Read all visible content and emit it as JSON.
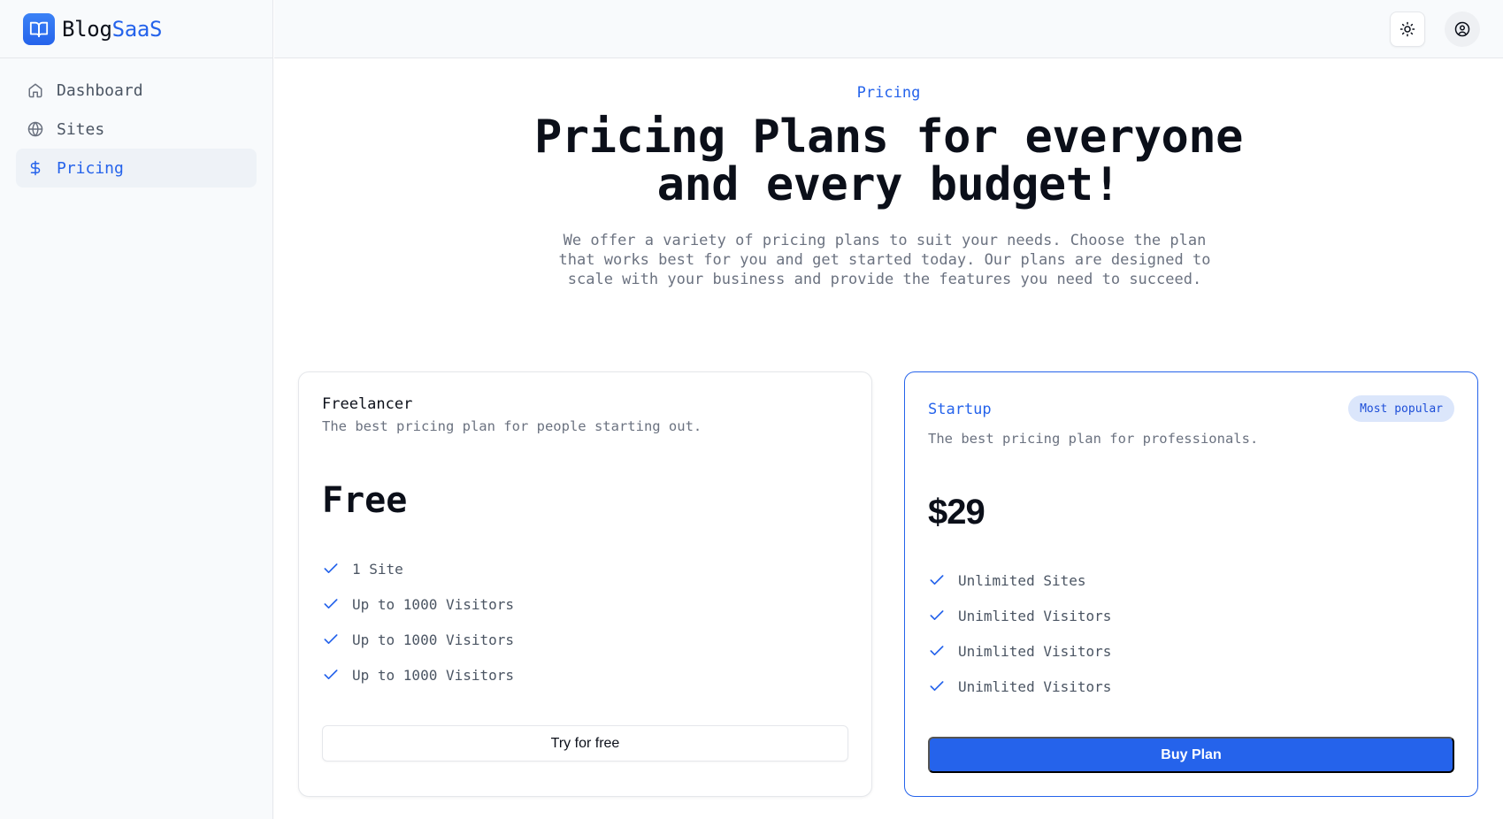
{
  "brand": {
    "name_prefix": "Blog",
    "name_suffix": "SaaS",
    "logo_icon": "book-open-icon"
  },
  "sidebar": {
    "items": [
      {
        "label": "Dashboard",
        "icon": "home-icon",
        "active": false
      },
      {
        "label": "Sites",
        "icon": "globe-icon",
        "active": false
      },
      {
        "label": "Pricing",
        "icon": "dollar-icon",
        "active": true
      }
    ]
  },
  "topbar": {
    "theme_icon": "sun-icon",
    "user_icon": "user-circle-icon"
  },
  "hero": {
    "eyebrow": "Pricing",
    "title_line1": "Pricing Plans for everyone",
    "title_line2": "and every budget!",
    "subtitle": "We offer a variety of pricing plans to suit your needs. Choose the plan that works best for you and get started today. Our plans are designed to scale with your business and provide the features you need to succeed."
  },
  "plans": [
    {
      "name": "Freelancer",
      "description": "The best pricing plan for people starting out.",
      "price": "Free",
      "features": [
        "1 Site",
        "Up to 1000 Visitors",
        "Up to 1000 Visitors",
        "Up to 1000 Visitors"
      ],
      "cta": "Try for free"
    },
    {
      "name": "Startup",
      "badge": "Most popular",
      "description": "The best pricing plan for professionals.",
      "price": "$29",
      "features": [
        "Unlimited Sites",
        "Unimlited Visitors",
        "Unimlited Visitors",
        "Unimlited Visitors"
      ],
      "cta": "Buy Plan"
    }
  ],
  "colors": {
    "accent": "#2563eb",
    "muted_text": "#6b7280",
    "border": "#e5e7eb",
    "sidebar_bg": "#f8fafc",
    "badge_bg": "#dbe6fb"
  }
}
